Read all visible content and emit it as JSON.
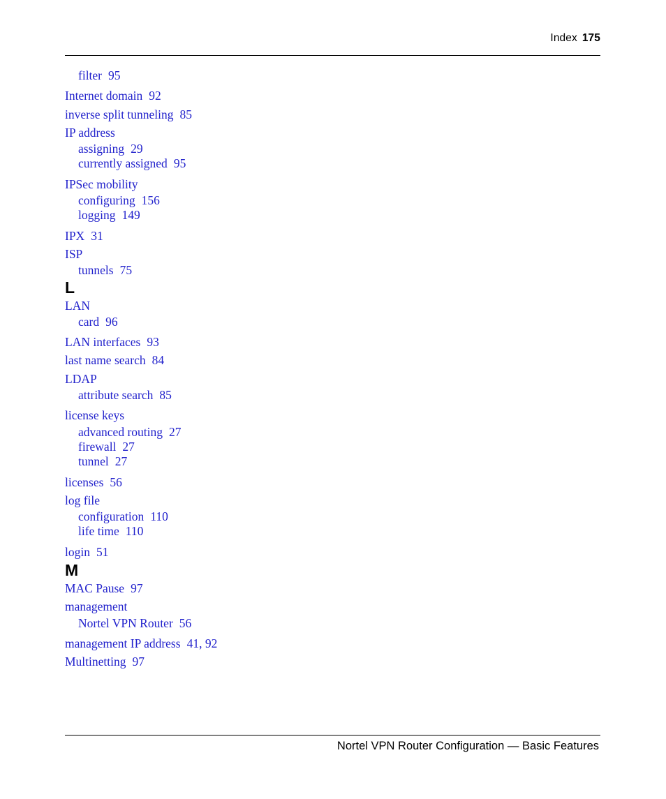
{
  "document": {
    "header": {
      "label": "Index",
      "page_number": "175"
    },
    "footer": {
      "text": "Nortel VPN Router Configuration — Basic Features"
    }
  },
  "index": {
    "blocks": [
      {
        "type": "entries",
        "entries": [
          {
            "level": 2,
            "term": "filter",
            "pages": "95"
          },
          {
            "level": 1,
            "term": "Internet domain",
            "pages": "92"
          },
          {
            "level": 1,
            "term": "inverse split tunneling",
            "pages": "85"
          },
          {
            "level": 1,
            "term": "IP address",
            "pages": ""
          },
          {
            "level": 2,
            "term": "assigning",
            "pages": "29"
          },
          {
            "level": 2,
            "term": "currently assigned",
            "pages": "95"
          },
          {
            "level": 1,
            "term": "IPSec mobility",
            "pages": ""
          },
          {
            "level": 2,
            "term": "configuring",
            "pages": "156"
          },
          {
            "level": 2,
            "term": "logging",
            "pages": "149"
          },
          {
            "level": 1,
            "term": "IPX",
            "pages": "31"
          },
          {
            "level": 1,
            "term": "ISP",
            "pages": ""
          },
          {
            "level": 2,
            "term": "tunnels",
            "pages": "75"
          }
        ]
      },
      {
        "type": "letter",
        "letter": "L",
        "entries": [
          {
            "level": 1,
            "term": "LAN",
            "pages": ""
          },
          {
            "level": 2,
            "term": "card",
            "pages": "96"
          },
          {
            "level": 1,
            "term": "LAN interfaces",
            "pages": "93"
          },
          {
            "level": 1,
            "term": "last name search",
            "pages": "84"
          },
          {
            "level": 1,
            "term": "LDAP",
            "pages": ""
          },
          {
            "level": 2,
            "term": "attribute search",
            "pages": "85"
          },
          {
            "level": 1,
            "term": "license keys",
            "pages": ""
          },
          {
            "level": 2,
            "term": "advanced routing",
            "pages": "27"
          },
          {
            "level": 2,
            "term": "firewall",
            "pages": "27"
          },
          {
            "level": 2,
            "term": "tunnel",
            "pages": "27"
          },
          {
            "level": 1,
            "term": "licenses",
            "pages": "56"
          },
          {
            "level": 1,
            "term": "log file",
            "pages": ""
          },
          {
            "level": 2,
            "term": "configuration",
            "pages": "110"
          },
          {
            "level": 2,
            "term": "life time",
            "pages": "110"
          },
          {
            "level": 1,
            "term": "login",
            "pages": "51"
          }
        ]
      },
      {
        "type": "letter",
        "letter": "M",
        "entries": [
          {
            "level": 1,
            "term": "MAC Pause",
            "pages": "97"
          },
          {
            "level": 1,
            "term": "management",
            "pages": ""
          },
          {
            "level": 2,
            "term": "Nortel VPN Router",
            "pages": "56"
          },
          {
            "level": 1,
            "term": "management IP address",
            "pages": "41, 92"
          },
          {
            "level": 1,
            "term": "Multinetting",
            "pages": "97"
          }
        ]
      }
    ]
  },
  "colors": {
    "entry_blue": "#2222cc",
    "text_black": "#000000",
    "page_background": "#ffffff"
  }
}
